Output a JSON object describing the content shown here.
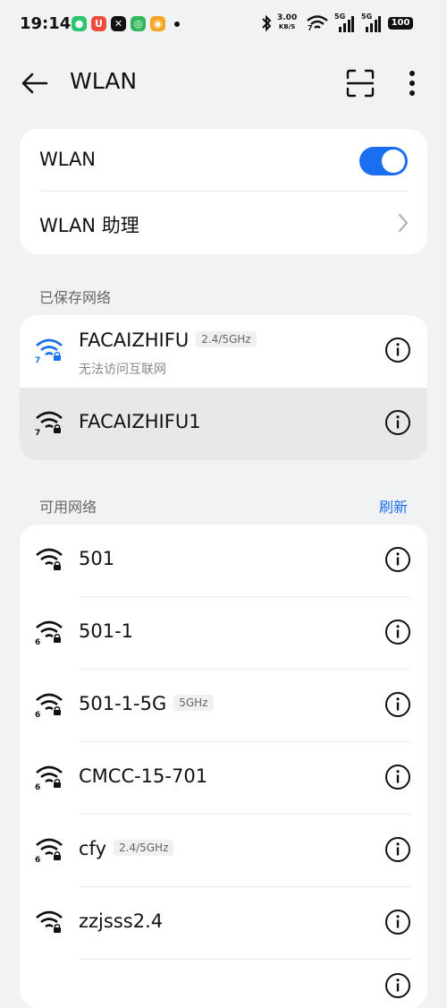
{
  "status_bar": {
    "time": "19:14",
    "speed_value": "3.00",
    "speed_unit": "KB/S",
    "wifi_badge": "7",
    "sim1_label": "5G",
    "sim2_label": "5G",
    "battery": "100",
    "app_icons": [
      "messages-app-icon",
      "shop-app-icon",
      "capcut-app-icon",
      "green-app-icon",
      "weibo-app-icon"
    ]
  },
  "header": {
    "title": "WLAN"
  },
  "wlan_card": {
    "toggle_label": "WLAN",
    "toggle_on": true,
    "assistant_label": "WLAN 助理"
  },
  "saved": {
    "section_label": "已保存网络",
    "networks": [
      {
        "name": "FACAIZHIFU",
        "band": "2.4/5GHz",
        "status": "无法访问互联网",
        "wifi_badge": "7",
        "connected": true
      },
      {
        "name": "FACAIZHIFU1",
        "band": "",
        "status": "",
        "wifi_badge": "7",
        "connected": false
      }
    ]
  },
  "available": {
    "section_label": "可用网络",
    "refresh_label": "刷新",
    "networks": [
      {
        "name": "501",
        "band": "",
        "wifi_badge": ""
      },
      {
        "name": "501-1",
        "band": "",
        "wifi_badge": "6"
      },
      {
        "name": "501-1-5G",
        "band": "5GHz",
        "wifi_badge": "6"
      },
      {
        "name": "CMCC-15-701",
        "band": "",
        "wifi_badge": "6"
      },
      {
        "name": "cfy",
        "band": "2.4/5GHz",
        "wifi_badge": "6"
      },
      {
        "name": "zzjsss2.4",
        "band": "",
        "wifi_badge": ""
      }
    ]
  },
  "colors": {
    "accent": "#1a6ff0",
    "background": "#f1f2f4",
    "card": "#ffffff"
  }
}
